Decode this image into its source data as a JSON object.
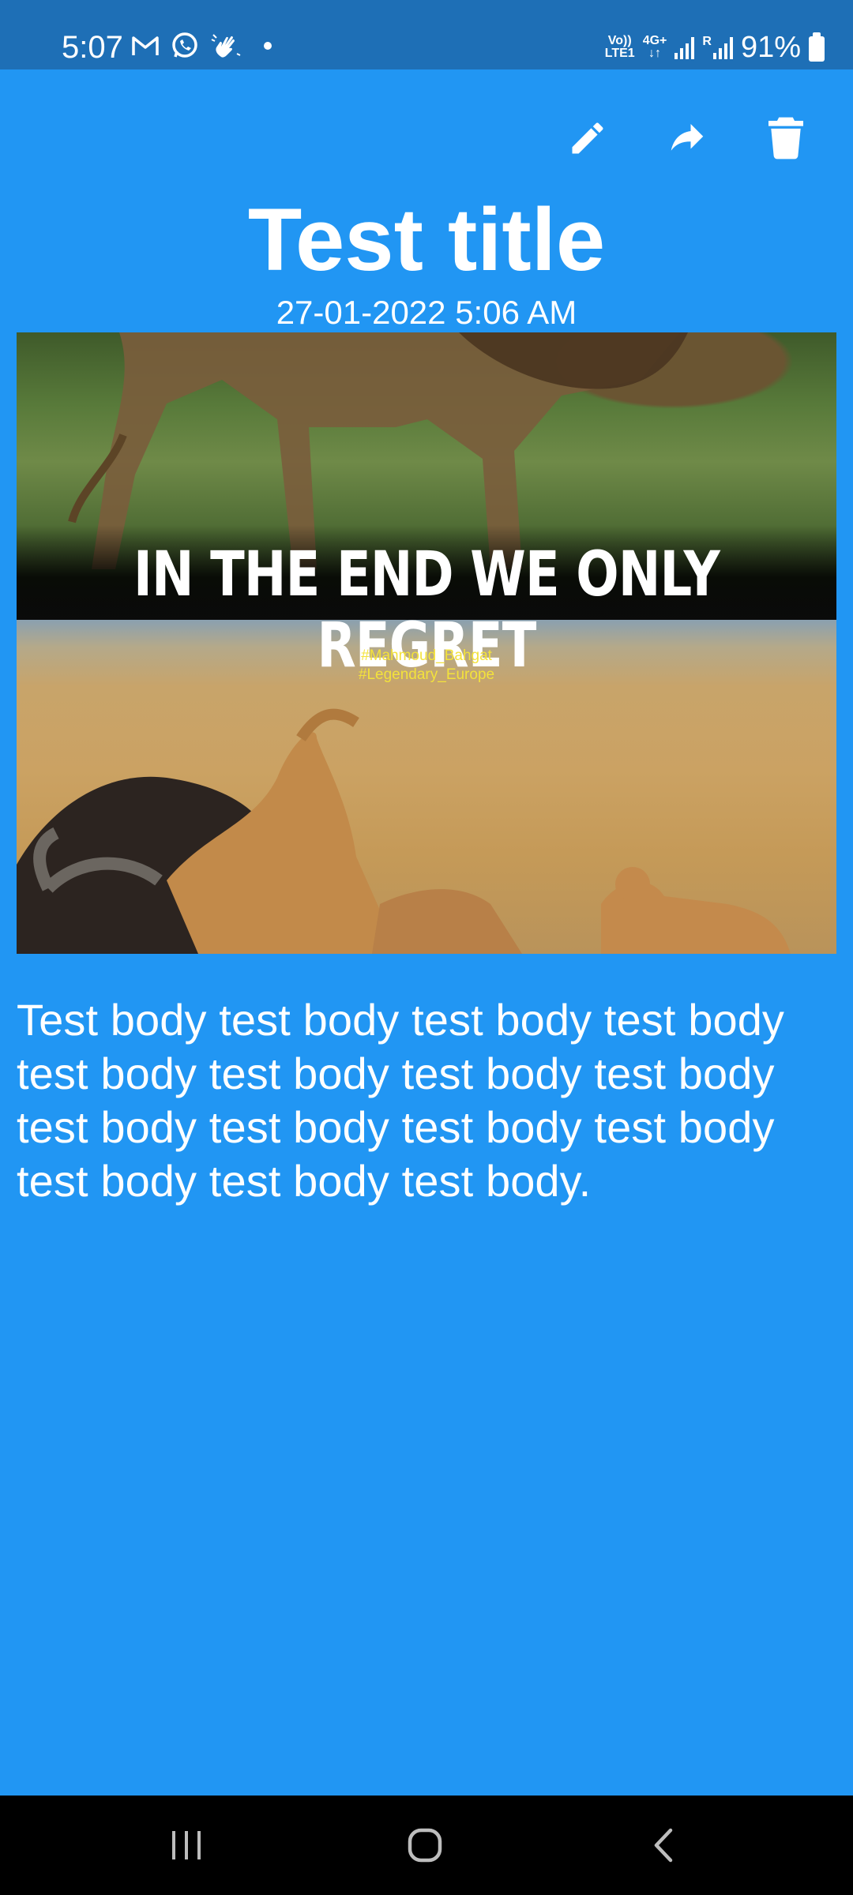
{
  "status_bar": {
    "time": "5:07",
    "network_top": "Vo))",
    "network_bottom": "LTE1",
    "network_type": "4G+",
    "roaming": "R",
    "battery": "91%"
  },
  "toolbar": {
    "edit_icon": "pencil-icon",
    "share_icon": "share-arrow-icon",
    "delete_icon": "trash-icon"
  },
  "note": {
    "title": "Test title",
    "timestamp": "27-01-2022 5:06 AM",
    "image": {
      "caption": "IN THE END WE ONLY REGRET",
      "tag_1": "#Mahmoud_Bahgat",
      "tag_2": "#Legendary_Europe"
    },
    "body": "Test body test body test body test body test body test body test body test body test body test body test body test body test body test body test body."
  },
  "colors": {
    "background": "#2196f3",
    "status_bar": "#1e6fb6",
    "nav_bar": "#000000",
    "text": "#ffffff"
  }
}
